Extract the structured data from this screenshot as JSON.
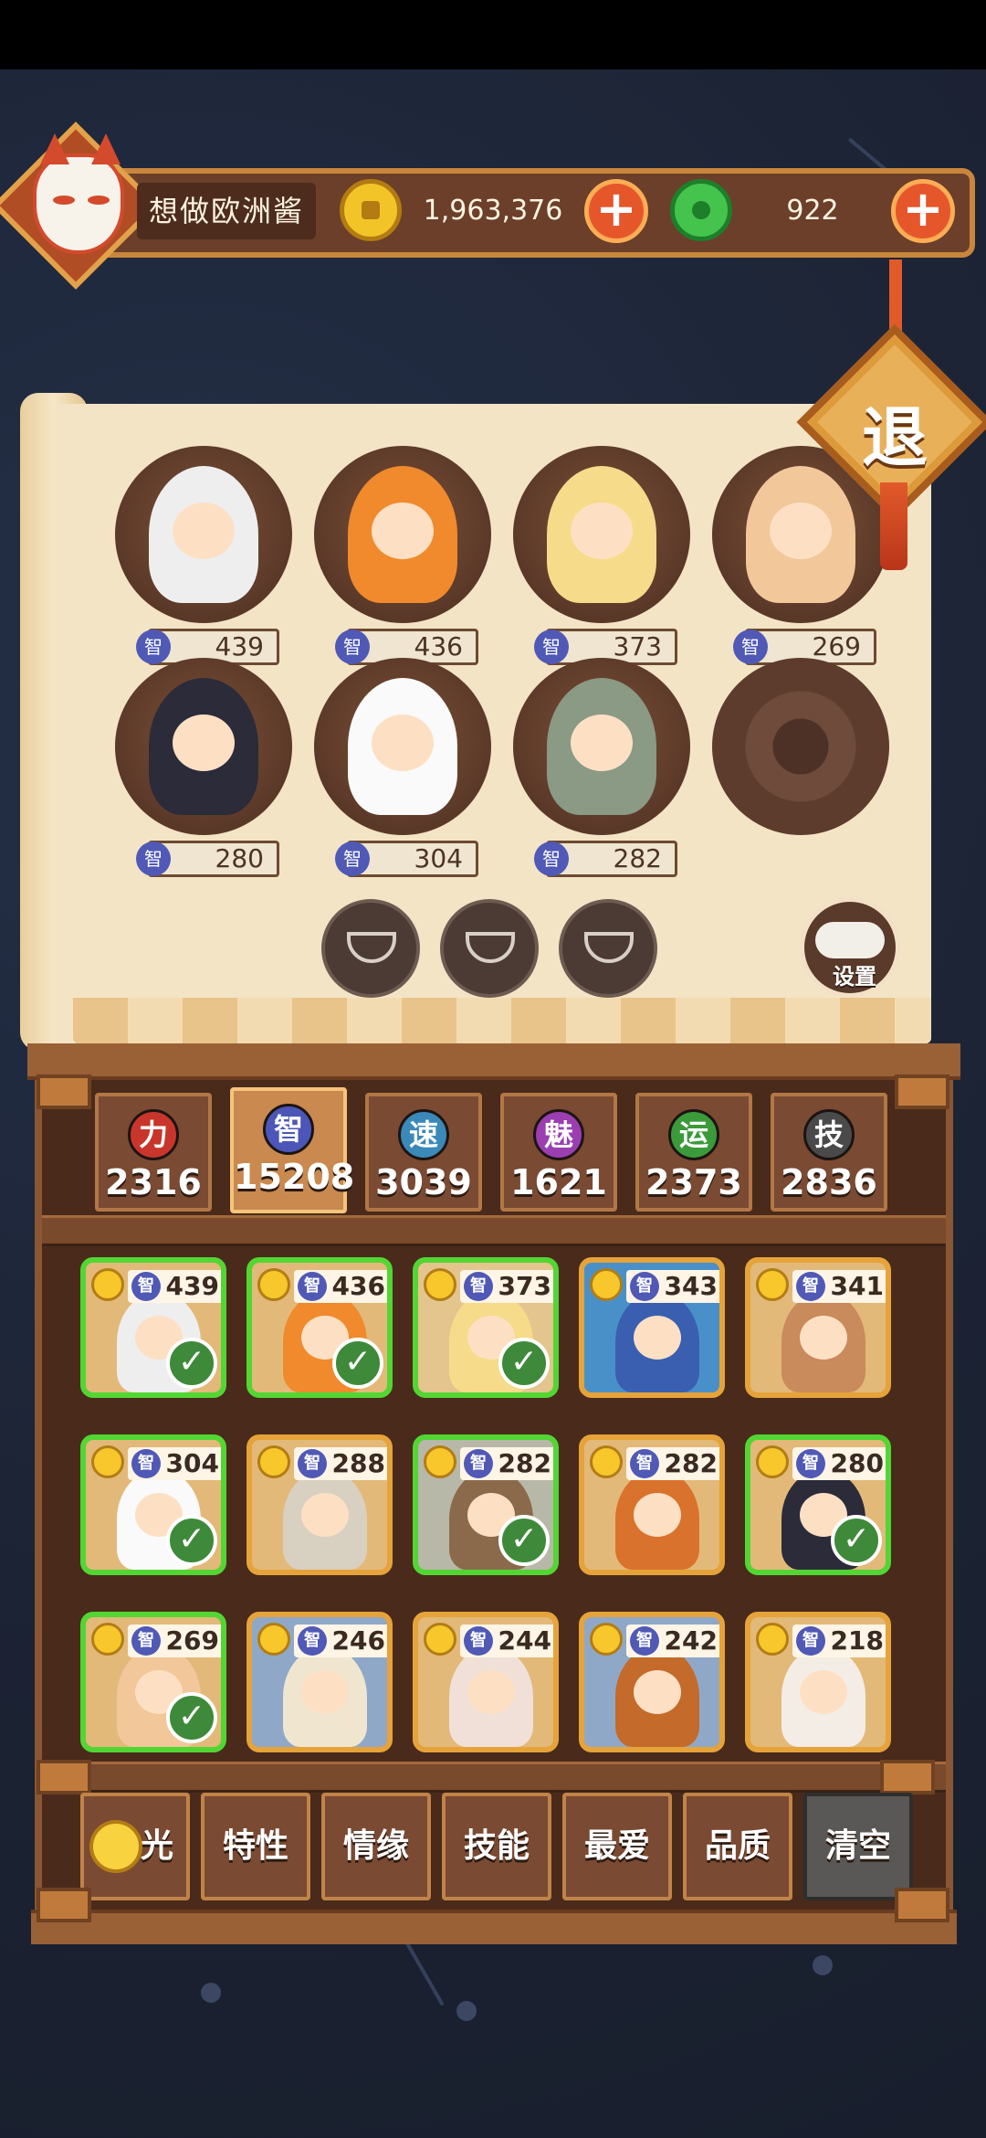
{
  "player": {
    "name": "想做欧洲酱"
  },
  "currency": {
    "gold": "1,963,376",
    "jade": "922"
  },
  "exit_label": "退",
  "settings_label": "设置",
  "lineup": [
    {
      "stat": "439",
      "robe": "#eeeeee"
    },
    {
      "stat": "436",
      "robe": "#f08a2c"
    },
    {
      "stat": "373",
      "robe": "#f6dc8a"
    },
    {
      "stat": "269",
      "robe": "#f2c79a"
    },
    {
      "stat": "280",
      "robe": "#2b2b3a"
    },
    {
      "stat": "304",
      "robe": "#fafafa"
    },
    {
      "stat": "282",
      "robe": "#8a9a84"
    },
    {
      "stat": null,
      "robe": null
    }
  ],
  "stat_badge": "智",
  "attributes": [
    {
      "icon": "力",
      "value": "2316",
      "color": "#c8362b",
      "active": false
    },
    {
      "icon": "智",
      "value": "15208",
      "color": "#4c56b8",
      "active": true
    },
    {
      "icon": "速",
      "value": "3039",
      "color": "#3a89b8",
      "active": false
    },
    {
      "icon": "魅",
      "value": "1621",
      "color": "#9a3eb0",
      "active": false
    },
    {
      "icon": "运",
      "value": "2373",
      "color": "#3b9a3a",
      "active": false
    },
    {
      "icon": "技",
      "value": "2836",
      "color": "#4a4a4a",
      "active": false
    }
  ],
  "heroes": [
    {
      "stat": "439",
      "selected": true,
      "bg": "#e3b979",
      "robe": "#eeeeee"
    },
    {
      "stat": "436",
      "selected": true,
      "bg": "#e3b979",
      "robe": "#f08a2c"
    },
    {
      "stat": "373",
      "selected": true,
      "bg": "#e3c58d",
      "robe": "#f6dc8a"
    },
    {
      "stat": "343",
      "selected": false,
      "bg": "#4a90c8",
      "robe": "#3a5fb0"
    },
    {
      "stat": "341",
      "selected": false,
      "bg": "#e3b979",
      "robe": "#c98a5c"
    },
    {
      "stat": "304",
      "selected": true,
      "bg": "#e3b979",
      "robe": "#fafafa"
    },
    {
      "stat": "288",
      "selected": false,
      "bg": "#e3b979",
      "robe": "#d8d0c0"
    },
    {
      "stat": "282",
      "selected": true,
      "bg": "#b8b8a8",
      "robe": "#8a6a4a"
    },
    {
      "stat": "282",
      "selected": false,
      "bg": "#e3b979",
      "robe": "#d9722c"
    },
    {
      "stat": "280",
      "selected": true,
      "bg": "#e3b979",
      "robe": "#2b2b3a"
    },
    {
      "stat": "269",
      "selected": true,
      "bg": "#e3b979",
      "robe": "#f2c79a"
    },
    {
      "stat": "246",
      "selected": false,
      "bg": "#8fa8c8",
      "robe": "#f0e6d0"
    },
    {
      "stat": "244",
      "selected": false,
      "bg": "#e3b979",
      "robe": "#f0e0d8"
    },
    {
      "stat": "242",
      "selected": false,
      "bg": "#8fa8c8",
      "robe": "#c46a2a"
    },
    {
      "stat": "218",
      "selected": false,
      "bg": "#e3b979",
      "robe": "#f4ede6"
    }
  ],
  "filters": [
    {
      "label": "光",
      "key": "light"
    },
    {
      "label": "特性",
      "key": "trait"
    },
    {
      "label": "情缘",
      "key": "bond"
    },
    {
      "label": "技能",
      "key": "skill"
    },
    {
      "label": "最爱",
      "key": "favorite"
    },
    {
      "label": "品质",
      "key": "quality"
    },
    {
      "label": "清空",
      "key": "clear"
    }
  ]
}
